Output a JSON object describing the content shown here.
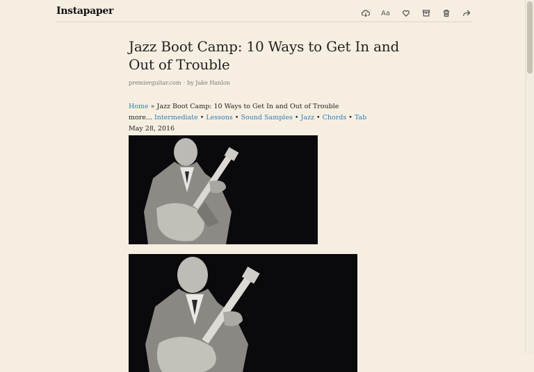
{
  "app": {
    "brand": "Instapaper"
  },
  "toolbar": {
    "icons": [
      "cloud-download-icon",
      "font-size-icon",
      "heart-icon",
      "archive-icon",
      "trash-icon",
      "share-icon"
    ],
    "font_label": "Aa"
  },
  "article": {
    "title": "Jazz Boot Camp: 10 Ways to Get In and Out of Trouble",
    "source": "premierguitar.com",
    "byline": "by Jake Hanlon",
    "breadcrumb": {
      "home": "Home",
      "separator": "»",
      "current": "Jazz Boot Camp: 10 Ways to Get In and Out of Trouble"
    },
    "more_label": "more...",
    "tags": [
      "Intermediate",
      "Lessons",
      "Sound Samples",
      "Jazz",
      "Chords",
      "Tab"
    ],
    "tag_separator": "•",
    "date": "May 28, 2016"
  }
}
